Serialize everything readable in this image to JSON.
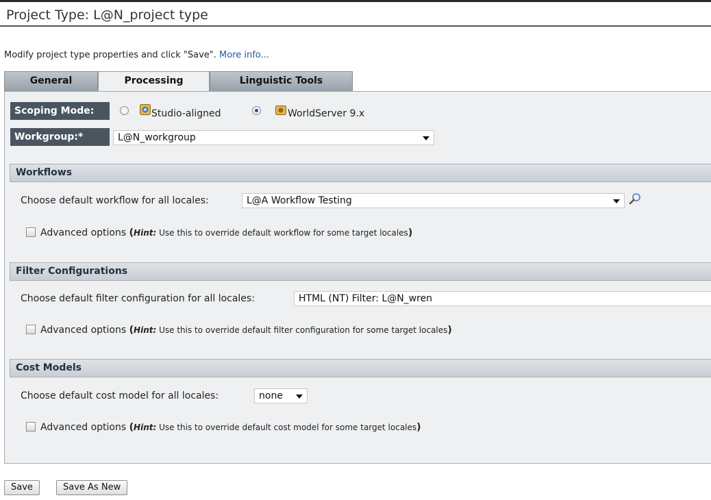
{
  "header": {
    "title": "Project Type: L@N_project type"
  },
  "intro": {
    "text": "Modify project type properties and click \"Save\". ",
    "link": "More info..."
  },
  "tabs": [
    {
      "label": "General",
      "active": false
    },
    {
      "label": "Processing",
      "active": true
    },
    {
      "label": "Linguistic Tools",
      "active": false
    }
  ],
  "scoping": {
    "label": "Scoping Mode:",
    "options": [
      {
        "label": "Studio-aligned",
        "selected": false
      },
      {
        "label": "WorldServer 9.x",
        "selected": true
      }
    ]
  },
  "workgroup": {
    "label": "Workgroup:*",
    "value": "L@N_workgroup"
  },
  "workflows": {
    "header": "Workflows",
    "choose_label": "Choose default workflow for all locales:",
    "value": "L@A Workflow Testing",
    "advanced": {
      "label": "Advanced options",
      "hint_label": "Hint:",
      "hint_text": " Use this to override default workflow for some target locales",
      "checked": false
    }
  },
  "filters": {
    "header": "Filter Configurations",
    "choose_label": "Choose default filter configuration for all locales:",
    "value": "HTML (NT) Filter: L@N_wren",
    "advanced": {
      "label": "Advanced options",
      "hint_label": "Hint:",
      "hint_text": " Use this to override default filter configuration for some target locales",
      "checked": false
    }
  },
  "cost_models": {
    "header": "Cost Models",
    "choose_label": "Choose default cost model for all locales:",
    "value": "none",
    "advanced": {
      "label": "Advanced options",
      "hint_label": "Hint:",
      "hint_text": " Use this to override default cost model for some target locales",
      "checked": false
    }
  },
  "buttons": {
    "save": "Save",
    "save_as_new": "Save As New"
  },
  "colors": {
    "label_bg": "#4a5560",
    "panel_bg": "#eef0f2",
    "link": "#2255aa",
    "section_header": "#c7ced4"
  },
  "icons": [
    "studio-app-icon",
    "worldserver-app-icon",
    "magnifier-icon",
    "dropdown-arrow-icon"
  ]
}
